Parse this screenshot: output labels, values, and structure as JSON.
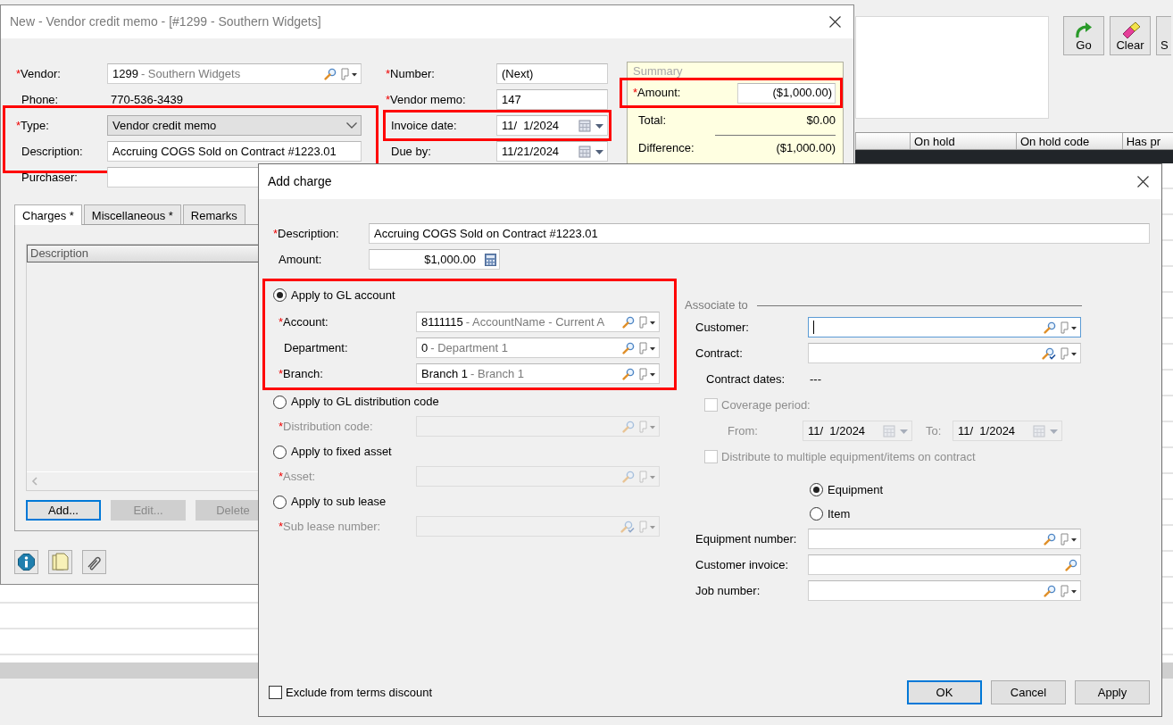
{
  "background": {
    "toolbar": [
      {
        "label": "Go",
        "kind": "go"
      },
      {
        "label": "Clear",
        "kind": "clear"
      },
      {
        "label": "S",
        "kind": "plain"
      }
    ],
    "table": {
      "columns": [
        "On hold",
        "On hold code",
        "Has pr"
      ]
    }
  },
  "memo": {
    "title": "New - Vendor credit memo - [#1299 - Southern Widgets]",
    "left_fields": [
      {
        "mark": "*",
        "label": "Vendor:",
        "kind": "lookup",
        "code": "1299",
        "name": "- Southern Widgets",
        "highlighted": false
      },
      {
        "label": "Phone:",
        "kind": "static",
        "value": "770-536-3439",
        "highlighted": false
      },
      {
        "mark": "*",
        "label": "Type:",
        "kind": "select",
        "value": "Vendor credit memo",
        "highlighted": true
      },
      {
        "label": "Description:",
        "kind": "text",
        "value": "Accruing COGS Sold on Contract #1223.01",
        "highlighted": true
      },
      {
        "label": "Purchaser:",
        "kind": "text",
        "highlighted": false
      }
    ],
    "right_fields": [
      {
        "mark": "*",
        "label": "Number:",
        "kind": "text",
        "value": "(Next)",
        "highlighted": false
      },
      {
        "mark": "*",
        "label": "Vendor memo:",
        "kind": "text",
        "value": "147",
        "highlighted": false
      },
      {
        "label": "Invoice date:",
        "kind": "date",
        "value": "11/  1/2024",
        "highlighted": true
      },
      {
        "label": "Due by:",
        "kind": "date",
        "value": "11/21/2024",
        "highlighted": false
      }
    ],
    "summary": {
      "title": "Summary",
      "rows": [
        {
          "mark": "*",
          "label": "Amount:",
          "kind": "field",
          "value": "($1,000.00)",
          "highlighted": true
        },
        {
          "label": "Total:",
          "kind": "static",
          "value": "$0.00",
          "highlighted": false
        },
        {
          "label": "Difference:",
          "kind": "result",
          "value": "($1,000.00)",
          "highlighted": false
        }
      ]
    },
    "tabs": [
      {
        "label": "Charges *",
        "selected": true
      },
      {
        "label": "Miscellaneous *",
        "selected": false
      },
      {
        "label": "Remarks",
        "selected": false
      }
    ],
    "charges_table": {
      "columns": [
        "Description"
      ]
    },
    "buttons": [
      {
        "label": "Add...",
        "disabled": false,
        "default": true
      },
      {
        "label": "Edit...",
        "disabled": true,
        "default": false
      },
      {
        "label": "Delete",
        "disabled": true,
        "default": false
      }
    ]
  },
  "dialog": {
    "title": "Add charge",
    "description": {
      "mark": "*",
      "label": "Description:",
      "kind": "text",
      "value": "Accruing COGS Sold on Contract #1223.01"
    },
    "amount": {
      "label": "Amount:",
      "kind": "money",
      "value": "$1,000.00"
    },
    "options": [
      {
        "label": "Apply to GL account",
        "selected": true,
        "highlighted": true,
        "fields": [
          {
            "mark": "*",
            "label": "Account:",
            "kind": "lookup",
            "code": "8111115",
            "name": "- AccountName - Current A",
            "disabled": false
          },
          {
            "label": "Department:",
            "kind": "lookup",
            "code": "0",
            "name": "- Department 1",
            "disabled": false
          },
          {
            "mark": "*",
            "label": "Branch:",
            "kind": "lookup",
            "code": "Branch 1",
            "name": "- Branch 1",
            "disabled": false
          }
        ]
      },
      {
        "label": "Apply to GL distribution code",
        "selected": false,
        "highlighted": false,
        "fields": [
          {
            "mark": "*",
            "label": "Distribution code:",
            "kind": "lookup",
            "disabled": true
          }
        ]
      },
      {
        "label": "Apply to fixed asset",
        "selected": false,
        "highlighted": false,
        "fields": [
          {
            "mark": "*",
            "label": "Asset:",
            "kind": "lookup",
            "disabled": true
          }
        ]
      },
      {
        "label": "Apply to sub lease",
        "selected": false,
        "highlighted": false,
        "fields": [
          {
            "mark": "*",
            "label": "Sub lease number:",
            "kind": "lookup_check",
            "disabled": true
          }
        ]
      }
    ],
    "associate": {
      "title": "Associate to",
      "rows": [
        {
          "kind": "lookup",
          "label": "Customer:",
          "focused": true
        },
        {
          "kind": "lookup_check",
          "label": "Contract:"
        },
        {
          "kind": "info",
          "label": "Contract dates:",
          "dates": "---"
        },
        {
          "kind": "checkbox",
          "label": "Coverage period:",
          "checked": false,
          "disabled": true
        },
        {
          "kind": "range",
          "from_label": "From:",
          "from": "11/  1/2024",
          "to_label": "To:",
          "to": "11/  1/2024",
          "disabled": true
        },
        {
          "kind": "checkbox",
          "label": "Distribute to multiple equipment/items on contract",
          "checked": false,
          "disabled": true
        },
        {
          "kind": "radio",
          "label": "Equipment",
          "selected": true
        },
        {
          "kind": "radio",
          "label": "Item",
          "selected": false
        },
        {
          "kind": "lookup",
          "label": "Equipment number:"
        },
        {
          "kind": "search",
          "label": "Customer invoice:"
        },
        {
          "kind": "lookup",
          "label": "Job number:"
        }
      ]
    },
    "exclude": {
      "label": "Exclude from terms discount",
      "checked": false
    },
    "buttons": [
      {
        "label": "OK",
        "default": true
      },
      {
        "label": "Cancel",
        "default": false
      },
      {
        "label": "Apply",
        "default": false
      }
    ]
  }
}
